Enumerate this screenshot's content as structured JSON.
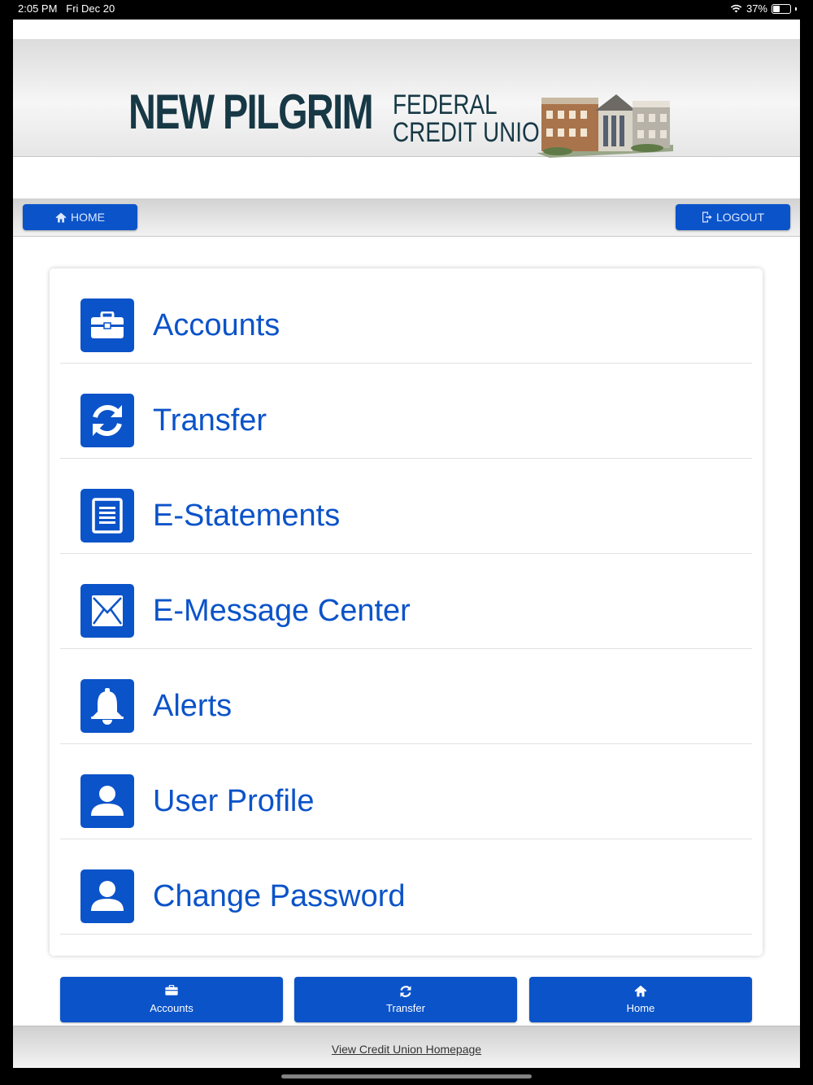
{
  "status_bar": {
    "time": "2:05 PM",
    "date": "Fri Dec 20",
    "battery": "37%",
    "wifi_icon": "wifi-icon",
    "battery_icon": "battery-icon"
  },
  "logo": {
    "name_main": "NEW PILGRIM",
    "name_sub_line1": "FEDERAL",
    "name_sub_line2": "CREDIT UNION",
    "image": "building-illustration"
  },
  "nav": {
    "home_label": "HOME",
    "home_icon": "home-icon",
    "logout_label": "LOGOUT",
    "logout_icon": "logout-icon"
  },
  "menu": {
    "items": [
      {
        "label": "Accounts",
        "icon": "briefcase-icon"
      },
      {
        "label": "Transfer",
        "icon": "refresh-icon"
      },
      {
        "label": "E-Statements",
        "icon": "document-icon"
      },
      {
        "label": "E-Message Center",
        "icon": "envelope-icon"
      },
      {
        "label": "Alerts",
        "icon": "bell-icon"
      },
      {
        "label": "User Profile",
        "icon": "user-icon"
      },
      {
        "label": "Change Password",
        "icon": "user-icon"
      }
    ]
  },
  "quick_nav": [
    {
      "label": "Accounts",
      "icon": "briefcase-icon"
    },
    {
      "label": "Transfer",
      "icon": "refresh-icon"
    },
    {
      "label": "Home",
      "icon": "home-icon"
    }
  ],
  "footer": {
    "link_label": "View Credit Union Homepage"
  },
  "colors": {
    "accent": "#0b53c9",
    "logo_text": "#173845"
  }
}
